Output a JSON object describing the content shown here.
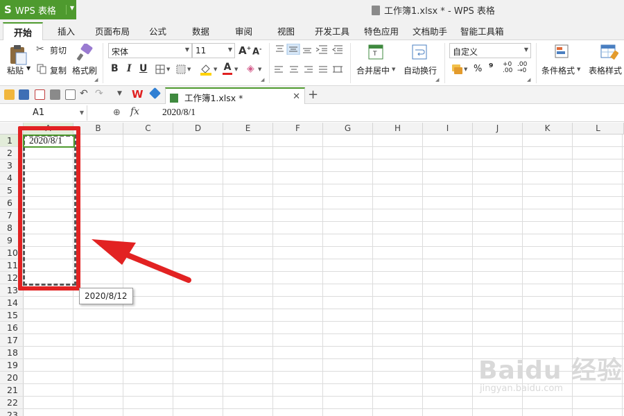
{
  "app": {
    "logo_letter": "S",
    "name": "WPS 表格",
    "doc_title": "工作簿1.xlsx * - WPS 表格"
  },
  "tabs": [
    "开始",
    "插入",
    "页面布局",
    "公式",
    "数据",
    "审阅",
    "视图",
    "开发工具",
    "特色应用",
    "文档助手",
    "智能工具箱"
  ],
  "ribbon": {
    "paste": "粘贴",
    "cut": "剪切",
    "copy": "复制",
    "format_painter": "格式刷",
    "font_name": "宋体",
    "font_size": "11",
    "bold": "B",
    "italic": "I",
    "underline": "U",
    "font_color_letter": "A",
    "merge_center": "合并居中",
    "wrap_text": "自动换行",
    "number_format": "自定义",
    "percent": "%",
    "thousands": "⁹",
    "conditional_format": "条件格式",
    "table_style": "表格样式"
  },
  "document_tab": {
    "name": "工作簿1.xlsx *"
  },
  "formula_bar": {
    "name_box": "A1",
    "fx": "fx",
    "value": "2020/8/1"
  },
  "sheet": {
    "columns": [
      "A",
      "B",
      "C",
      "D",
      "E",
      "F",
      "G",
      "H",
      "I",
      "J",
      "K",
      "L"
    ],
    "rows": [
      "1",
      "2",
      "3",
      "4",
      "5",
      "6",
      "7",
      "8",
      "9",
      "10",
      "11",
      "12",
      "13",
      "14",
      "15",
      "16",
      "17",
      "18",
      "19",
      "20",
      "21",
      "22",
      "23"
    ],
    "a1_value": "2020/8/1",
    "fill_tooltip": "2020/8/12"
  },
  "colors": {
    "accent": "#4e9a2e",
    "annotation": "#e22222"
  },
  "watermark": {
    "main": "Baidu 经验",
    "sub": "jingyan.baidu.com"
  }
}
